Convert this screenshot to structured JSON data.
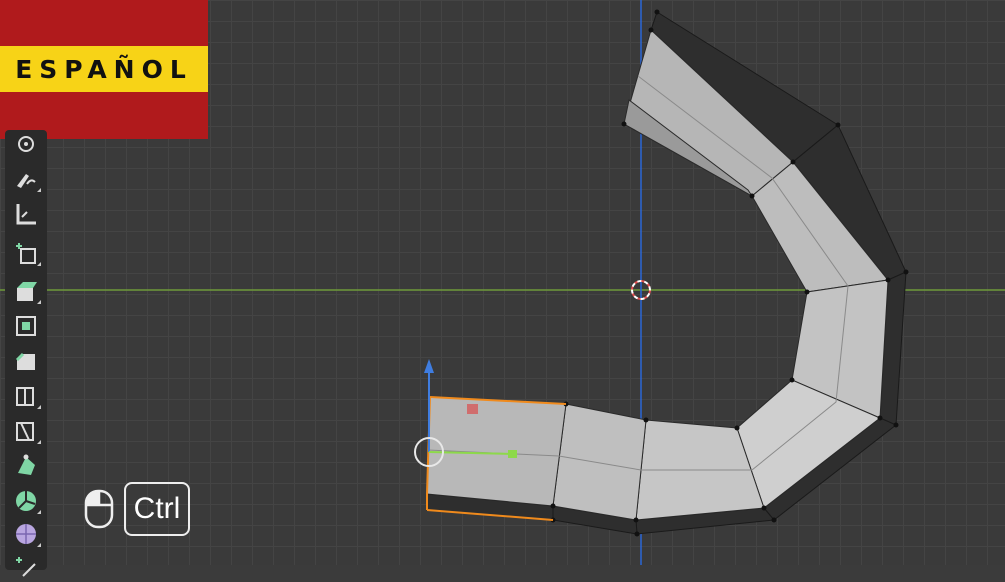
{
  "badge": {
    "language": "ESPAÑOL"
  },
  "colors": {
    "flag_red": "#b01a1c",
    "flag_yellow": "#f7d317",
    "axis_x": "#6e9a3a",
    "axis_z": "#2b66d6",
    "selection": "#f08a1c",
    "gizmo_up": "#3f7de0",
    "gizmo_right": "#8dd94a",
    "gizmo_handle": "#d65a5a"
  },
  "toolbar": {
    "tools": [
      {
        "icon": "transform-icon"
      },
      {
        "icon": "annotate-icon"
      },
      {
        "icon": "measure-icon"
      },
      {
        "icon": "add-cube-icon"
      },
      {
        "icon": "extrude-region-icon"
      },
      {
        "icon": "inset-faces-icon"
      },
      {
        "icon": "bevel-icon"
      },
      {
        "icon": "loop-cut-icon"
      },
      {
        "icon": "knife-icon"
      },
      {
        "icon": "poly-build-icon"
      },
      {
        "icon": "spin-icon"
      },
      {
        "icon": "smooth-icon"
      },
      {
        "icon": "edge-slide-icon"
      }
    ]
  },
  "hint": {
    "mouse_icon": "mouse-icon",
    "key_label": "Ctrl"
  }
}
